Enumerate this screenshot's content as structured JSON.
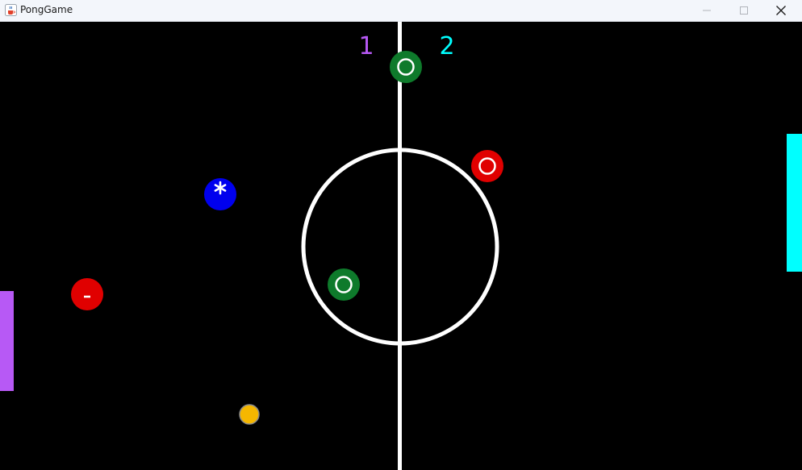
{
  "window": {
    "title": "PongGame",
    "app_icon": "java-coffee-cup-icon",
    "controls": [
      "minimize-icon",
      "maximize-icon",
      "close-icon"
    ]
  },
  "game": {
    "score_player1": "1",
    "score_player2": "2",
    "colors": {
      "background": "#000000",
      "field_lines": "#ffffff",
      "player1": "#b759f5",
      "player2": "#00ffff",
      "ball": "#f5b700",
      "powerup_green": "#0e7a2b",
      "powerup_red": "#e00000",
      "powerup_blue": "#0000ee"
    },
    "powerups": [
      {
        "name": "powerup-green-top",
        "color": "#0e7a2b",
        "symbol": "ring"
      },
      {
        "name": "powerup-red-right",
        "color": "#e00000",
        "symbol": "ring"
      },
      {
        "name": "powerup-blue-star",
        "color": "#0000ee",
        "symbol": "*"
      },
      {
        "name": "powerup-green-center",
        "color": "#0e7a2b",
        "symbol": "ring"
      },
      {
        "name": "powerup-red-minus",
        "color": "#e00000",
        "symbol": "-"
      }
    ]
  }
}
